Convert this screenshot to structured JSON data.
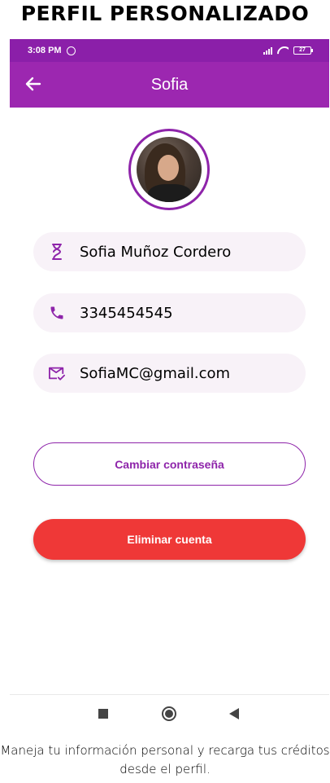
{
  "page_heading": "PERFIL PERSONALIZADO",
  "status_bar": {
    "time": "3:08 PM",
    "battery": "27"
  },
  "app_bar": {
    "title": "Sofia"
  },
  "profile": {
    "name": "Sofia Muñoz Cordero",
    "phone": "3345454545",
    "email": "SofiaMC@gmail.com"
  },
  "buttons": {
    "change_password": "Cambiar contraseña",
    "delete_account": "Eliminar cuenta"
  },
  "caption": "Maneja tu información personal y recarga tus créditos desde el perfil.",
  "colors": {
    "primary": "#9c27b0",
    "status_bar": "#8b1fa9",
    "danger": "#ef3837",
    "field_bg": "#f8f2f8"
  },
  "icons": {
    "back": "arrow-left-icon",
    "name": "hourglass-icon",
    "phone": "phone-icon",
    "email": "mail-check-icon"
  }
}
